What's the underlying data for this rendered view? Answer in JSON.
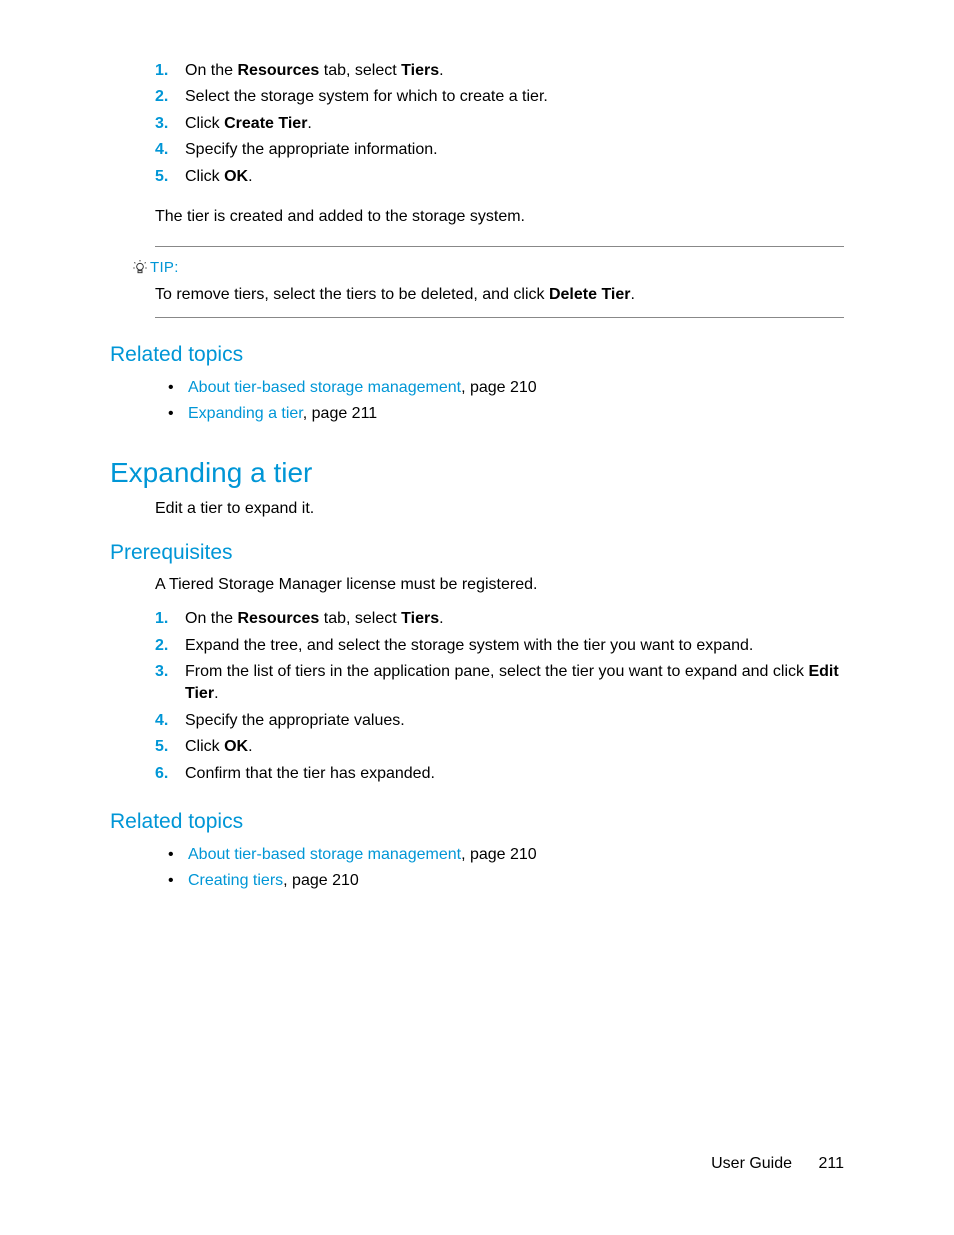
{
  "steps1": {
    "s1": {
      "num": "1.",
      "pre": "On the ",
      "b1": "Resources",
      "mid": " tab, select ",
      "b2": "Tiers",
      "post": "."
    },
    "s2": {
      "num": "2.",
      "txt": "Select the storage system for which to create a tier."
    },
    "s3": {
      "num": "3.",
      "pre": "Click ",
      "b1": "Create Tier",
      "post": "."
    },
    "s4": {
      "num": "4.",
      "txt": "Specify the appropriate information."
    },
    "s5": {
      "num": "5.",
      "pre": "Click ",
      "b1": "OK",
      "post": "."
    }
  },
  "para1": "The tier is created and added to the storage system.",
  "tip": {
    "label": "TIP:",
    "pre": "To remove tiers, select the tiers to be deleted, and click ",
    "bold": "Delete Tier",
    "post": "."
  },
  "related1": {
    "heading": "Related topics",
    "r1": {
      "link": "About tier-based storage management",
      "suffix": ", page 210"
    },
    "r2": {
      "link": "Expanding a tier",
      "suffix": ", page 211"
    }
  },
  "section2": {
    "heading": "Expanding a tier",
    "intro": "Edit a tier to expand it."
  },
  "prereq": {
    "heading": "Prerequisites",
    "txt": "A Tiered Storage Manager license must be registered."
  },
  "steps2": {
    "s1": {
      "num": "1.",
      "pre": "On the ",
      "b1": "Resources",
      "mid": " tab, select ",
      "b2": "Tiers",
      "post": "."
    },
    "s2": {
      "num": "2.",
      "txt": "Expand the tree, and select the storage system with the tier you want to expand."
    },
    "s3": {
      "num": "3.",
      "pre": "From the list of tiers in the application pane, select the tier you want to expand and click ",
      "b1": "Edit Tier",
      "post": "."
    },
    "s4": {
      "num": "4.",
      "txt": "Specify the appropriate values."
    },
    "s5": {
      "num": "5.",
      "pre": "Click ",
      "b1": "OK",
      "post": "."
    },
    "s6": {
      "num": "6.",
      "txt": "Confirm that the tier has expanded."
    }
  },
  "related2": {
    "heading": "Related topics",
    "r1": {
      "link": "About tier-based storage management",
      "suffix": ", page 210"
    },
    "r2": {
      "link": "Creating tiers",
      "suffix": ", page 210"
    }
  },
  "footer": {
    "title": "User Guide",
    "page": "211"
  }
}
